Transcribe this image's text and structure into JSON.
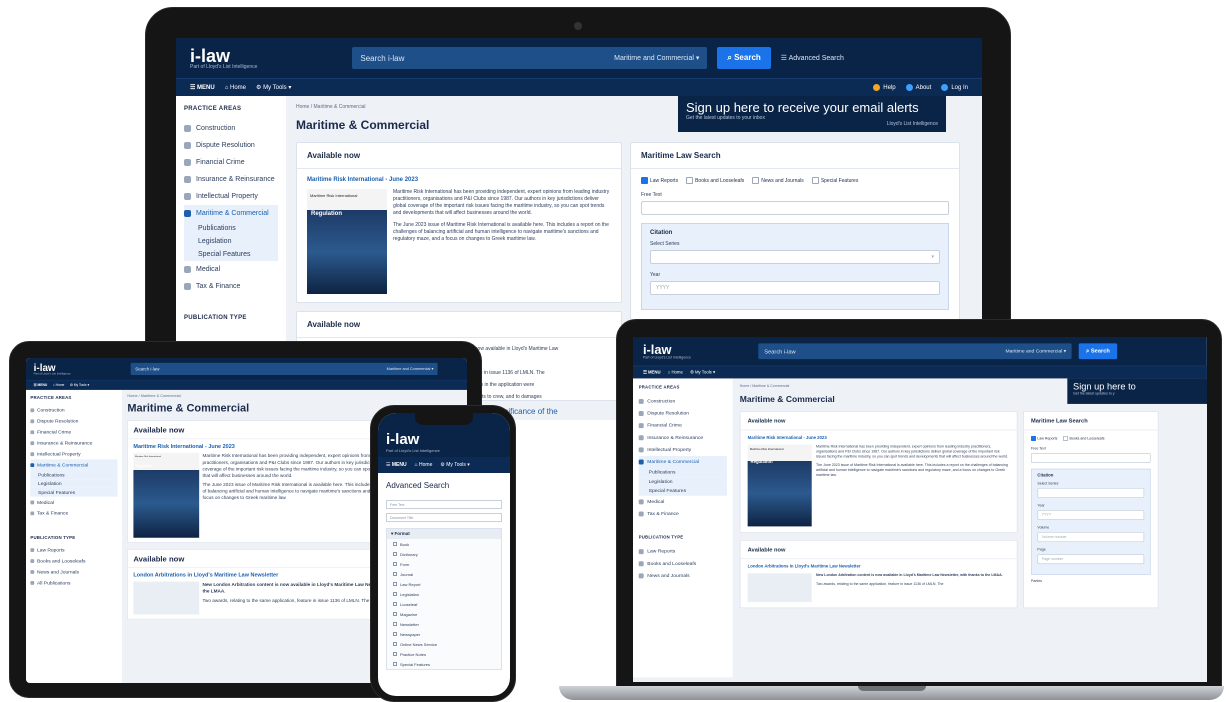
{
  "brand": {
    "logo": "i-law",
    "tagline": "Part of Lloyd's List Intelligence"
  },
  "header": {
    "search_placeholder": "Search i-law",
    "scope_select": "Maritime and Commercial",
    "search_button": "Search",
    "advanced_link": "Advanced Search",
    "nav": {
      "menu": "MENU",
      "home": "Home",
      "tools": "My Tools"
    },
    "right": {
      "help": "Help",
      "about": "About",
      "login": "Log In"
    }
  },
  "sidebar": {
    "heading": "PRACTICE AREAS",
    "items": [
      "Construction",
      "Dispute Resolution",
      "Financial Crime",
      "Insurance & Reinsurance",
      "Intellectual Property",
      "Maritime & Commercial",
      "Medical",
      "Tax & Finance"
    ],
    "subitems": [
      "Publications",
      "Legislation",
      "Special Features"
    ],
    "pub_heading": "PUBLICATION TYPE",
    "pub_items": [
      "Law Reports",
      "Books and Looseleafs",
      "News and Journals",
      "All Publications"
    ]
  },
  "page": {
    "breadcrumb": "Home / Maritime & Commercial",
    "title": "Maritime & Commercial"
  },
  "banner": {
    "line1": "Sign up here to receive your email alerts",
    "line2": "Get the latest updates to your inbox",
    "line3": "Lloyd's List Intelligence",
    "short1": "Sign up here to",
    "short2": "Get the latest updates to y"
  },
  "available": {
    "heading": "Available now",
    "article_title": "Maritime Risk International - June 2023",
    "cover_top": "Maritime Risk International",
    "cover_title": "Regulation",
    "p1": "Maritime Risk International has been providing independent, expert opinions from leading industry practitioners, organisations and P&I Clubs since 1987. Our authors in key jurisdictions deliver global coverage of the important risk issues facing the maritime industry, so you can spot trends and developments that will affect businesses around the world.",
    "p2": "The June 2023 issue of Maritime Risk International is available here. This includes a report on the challenges of balancing artificial and human intelligence to navigate maritime's sanctions and regulatory maze, and a focus on changes to Greek maritime law.",
    "second_title": "London Arbitrations in Lloyd's Maritime Law Newsletter",
    "second_p1": "New London Arbitration content is now available in Lloyd's Maritime Law Newsletter, with thanks to the LMAA.",
    "second_p2": "Two awards, relating to the same application, feature in issue 1136 of LMLN. The"
  },
  "desktop_peek": {
    "t1": "t is now available in Lloyd's Maritime Law",
    "t2": "LMAA.",
    "t3": "feature in issue 1136 of LMLN. The",
    "t4": "owners in the application were",
    "t5": "ayments to crew, and to damages",
    "t6": "ement: significance of the"
  },
  "search_panel": {
    "heading": "Maritime Law Search",
    "checks": [
      "Law Reports",
      "Books and Looseleafs",
      "News and Journals",
      "Special Features"
    ],
    "free_text": "Free Text",
    "citation": "Citation",
    "select_series": "Select Series",
    "year": "Year",
    "year_ph": "YYYY",
    "volume": "Volume",
    "volume_ph": "Volume number",
    "page": "Page",
    "page_ph": "Page number",
    "parties": "Parties"
  },
  "phone": {
    "title": "Advanced Search",
    "field1": "Free Text",
    "field2": "Document Title",
    "format_heading": "Format",
    "formats": [
      "Book",
      "Dictionary",
      "Form",
      "Journal",
      "Law Report",
      "Legislation",
      "Looseleaf",
      "Magazine",
      "Newsletter",
      "Newspaper",
      "Online News Service",
      "Practice Notes",
      "Special Features"
    ]
  }
}
